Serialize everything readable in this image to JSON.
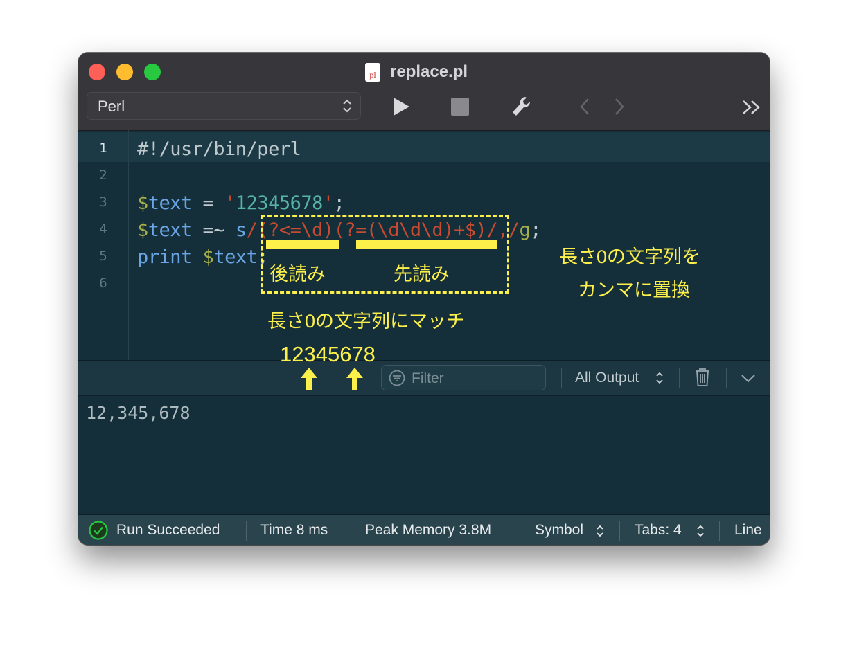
{
  "window": {
    "title": "replace.pl",
    "file_icon_text": "pl",
    "language": "Perl"
  },
  "editor": {
    "line_numbers": [
      "1",
      "2",
      "3",
      "4",
      "5",
      "6"
    ],
    "lines": [
      [
        {
          "t": "#!/usr/bin/perl",
          "c": "pun"
        }
      ],
      [],
      [
        {
          "t": "$",
          "c": "var"
        },
        {
          "t": "text",
          "c": "kw"
        },
        {
          "t": " = ",
          "c": "pun"
        },
        {
          "t": "'",
          "c": "str"
        },
        {
          "t": "12345678",
          "c": "num"
        },
        {
          "t": "'",
          "c": "str"
        },
        {
          "t": ";",
          "c": "pun"
        }
      ],
      [
        {
          "t": "$",
          "c": "var"
        },
        {
          "t": "text",
          "c": "kw"
        },
        {
          "t": " =~ ",
          "c": "pun"
        },
        {
          "t": "s",
          "c": "kw"
        },
        {
          "t": "/(?<=\\d)(?=(\\d\\d\\d)+$)/,/",
          "c": "re"
        },
        {
          "t": "g",
          "c": "var"
        },
        {
          "t": ";",
          "c": "pun"
        }
      ],
      [
        {
          "t": "print ",
          "c": "kw"
        },
        {
          "t": "$",
          "c": "var"
        },
        {
          "t": "text",
          "c": "kw"
        },
        {
          "t": ";",
          "c": "pun"
        }
      ],
      []
    ]
  },
  "console": {
    "filter_placeholder": "Filter",
    "output_scope": "All Output",
    "output_text": "12,345,678"
  },
  "status": {
    "result": "Run Succeeded",
    "time": "Time 8 ms",
    "memory": "Peak Memory 3.8M",
    "symbol": "Symbol",
    "tabs": "Tabs: 4",
    "line": "Line"
  },
  "annotations": {
    "lookbehind": "後読み",
    "lookahead": "先読み",
    "zero_width_match": "長さ0の文字列にマッチ",
    "sample_number": "12345678",
    "replace_line1": "長さ0の文字列を",
    "replace_line2": "カンマに置換"
  },
  "colors": {
    "annotation": "#fdf04a",
    "editor_bg": "#142f39",
    "success": "#28c840"
  }
}
